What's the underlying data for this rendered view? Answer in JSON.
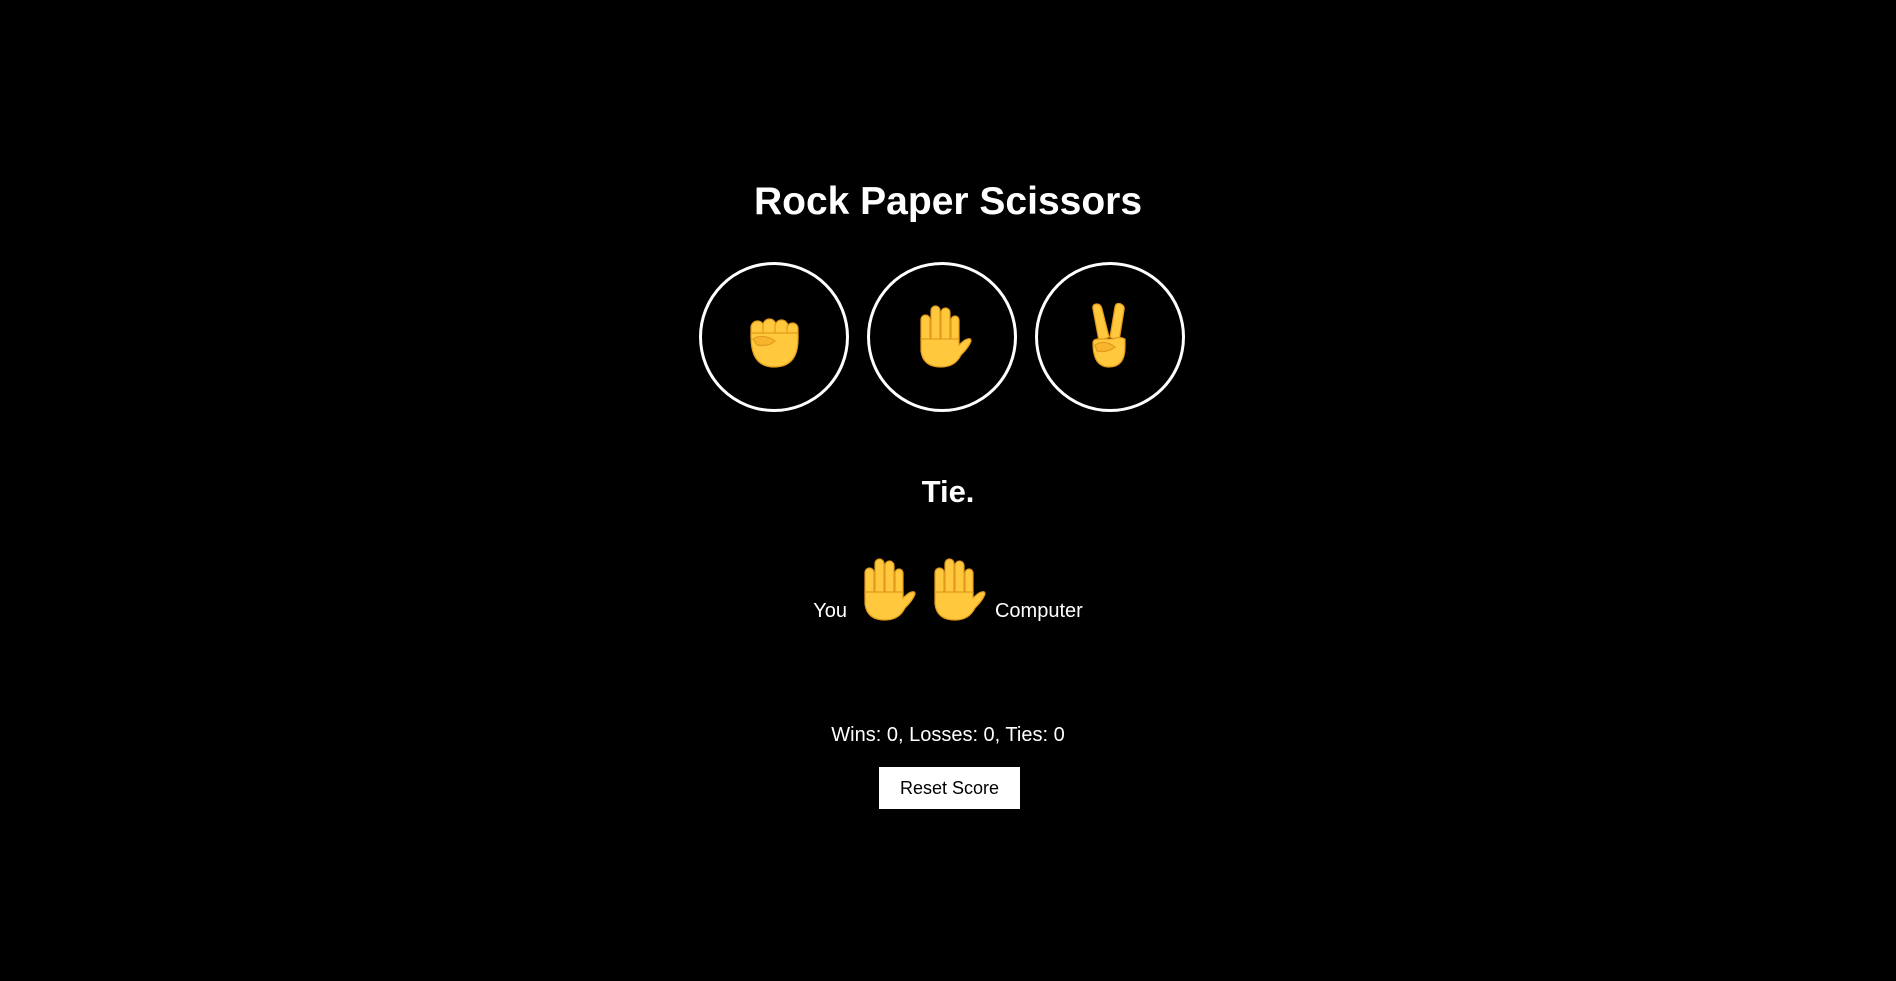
{
  "title": "Rock Paper Scissors",
  "choices": [
    {
      "name": "rock",
      "icon": "raised-fist-icon"
    },
    {
      "name": "paper",
      "icon": "raised-hand-icon"
    },
    {
      "name": "scissors",
      "icon": "victory-hand-icon"
    }
  ],
  "result": "Tie.",
  "moves": {
    "you_label": "You",
    "computer_label": "Computer",
    "you_icon": "raised-hand-icon",
    "computer_icon": "raised-hand-icon"
  },
  "score": {
    "text": "Wins: 0, Losses: 0, Ties: 0"
  },
  "reset_label": "Reset Score",
  "colors": {
    "background": "#000000",
    "text": "#ffffff",
    "hand_fill": "#FFC83D",
    "hand_shade": "#F0A830"
  }
}
